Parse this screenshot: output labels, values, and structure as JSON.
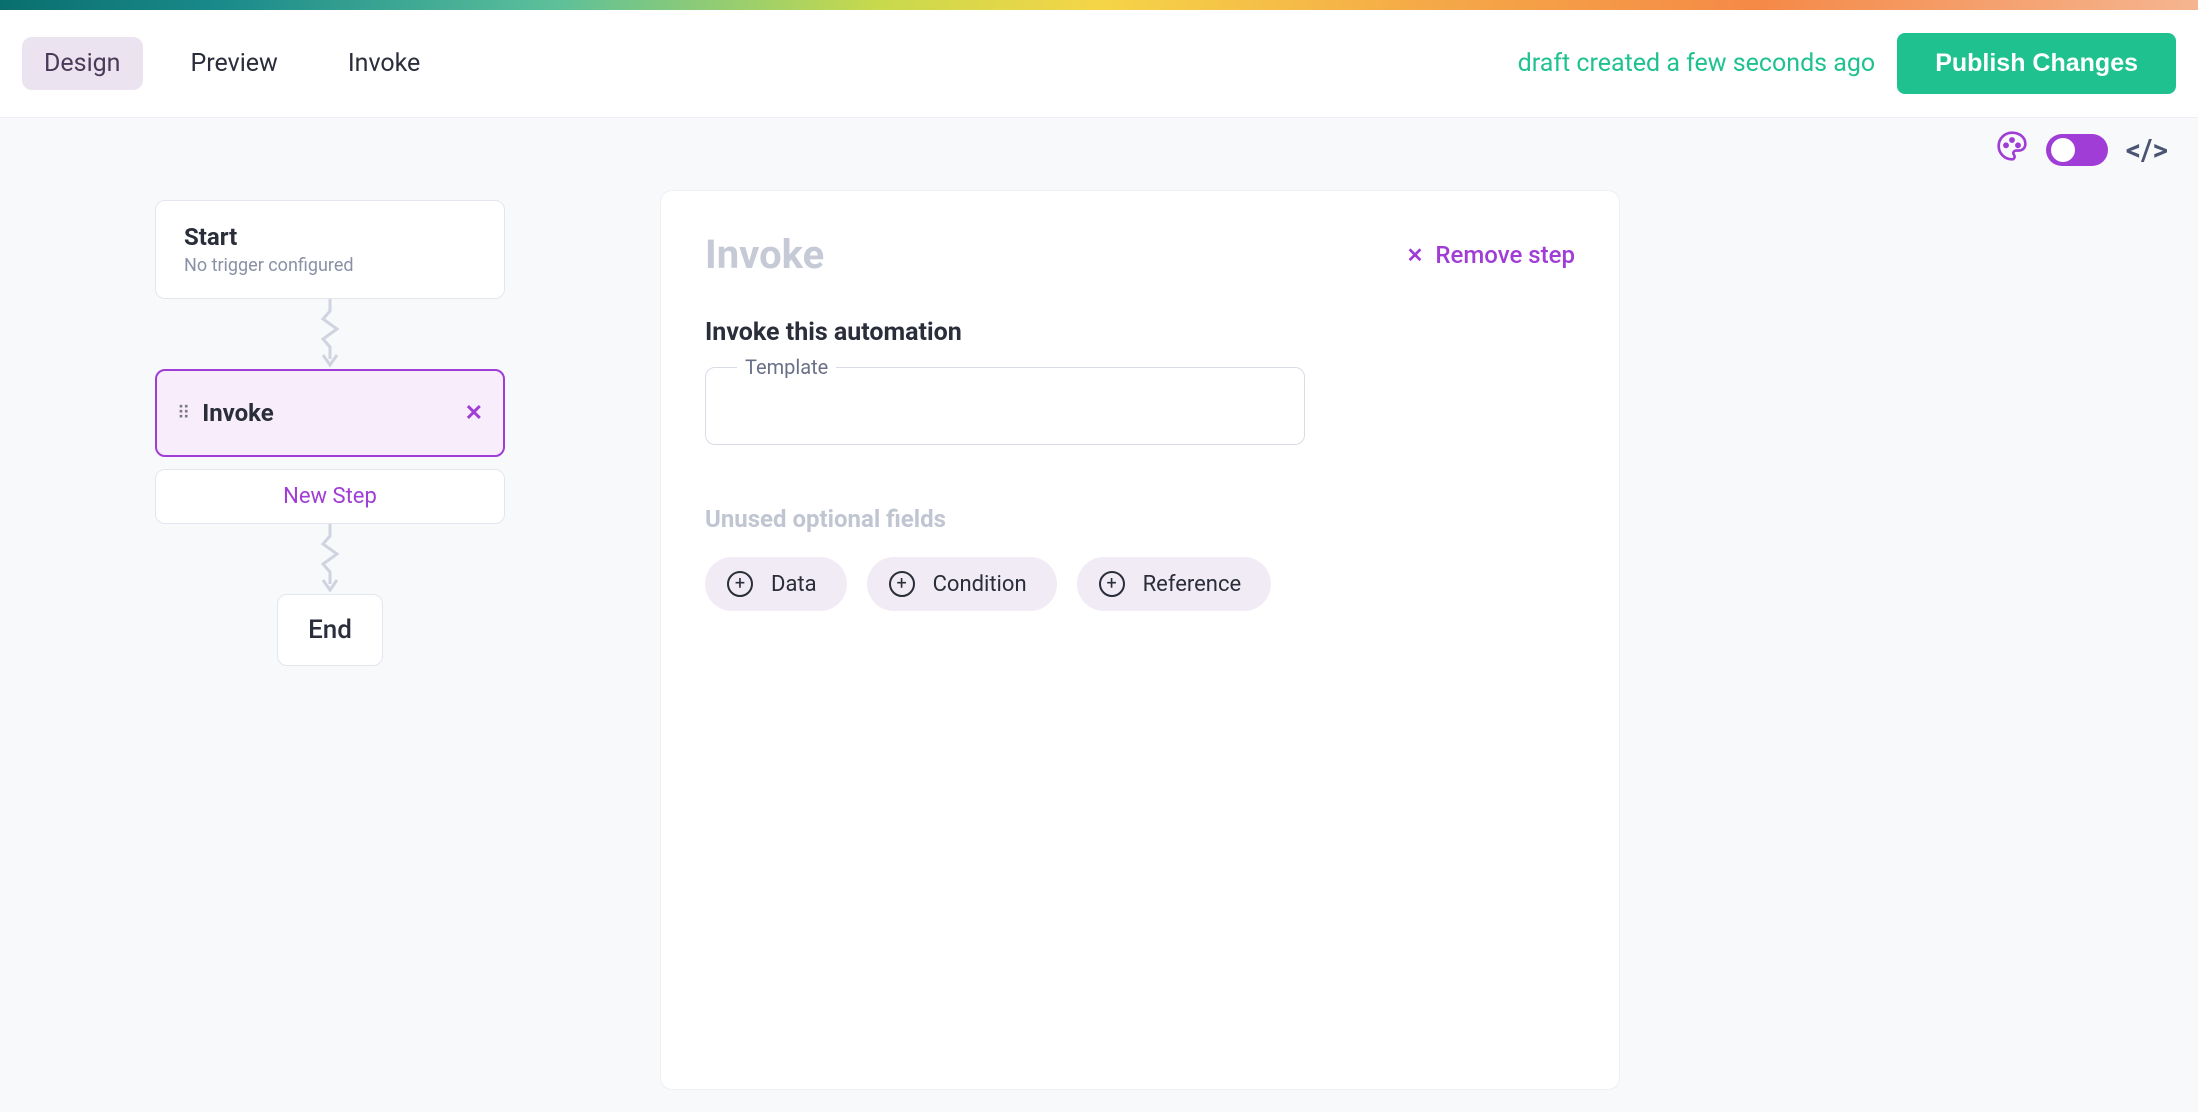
{
  "header": {
    "tabs": {
      "design": "Design",
      "preview": "Preview",
      "invoke": "Invoke"
    },
    "draft_status": "draft created a few seconds ago",
    "publish_label": "Publish Changes"
  },
  "flow": {
    "start": {
      "title": "Start",
      "subtitle": "No trigger configured"
    },
    "invoke_step": {
      "label": "Invoke"
    },
    "new_step_label": "New Step",
    "end_label": "End"
  },
  "detail": {
    "title": "Invoke",
    "remove_step_label": "Remove step",
    "section_label": "Invoke this automation",
    "template_label": "Template",
    "template_value": "",
    "optional_label": "Unused optional fields",
    "chips": {
      "data": "Data",
      "condition": "Condition",
      "reference": "Reference"
    }
  }
}
